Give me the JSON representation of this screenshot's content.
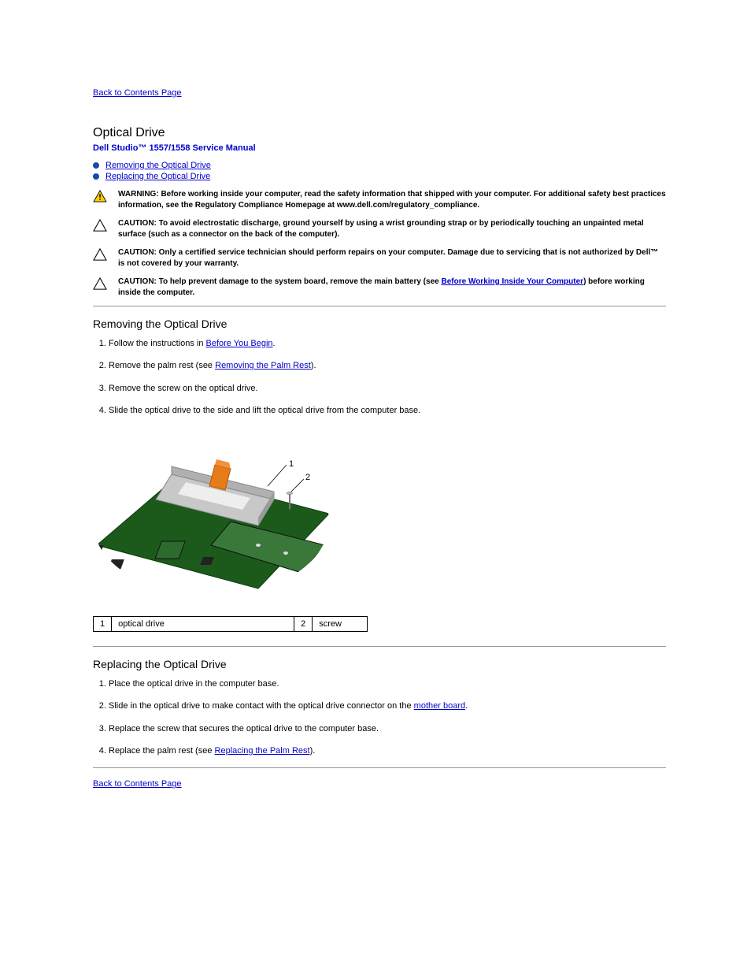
{
  "nav": {
    "back_top": "Back to Contents Page",
    "back_bottom": "Back to Contents Page"
  },
  "header": {
    "title": "Optical Drive",
    "manual": "Dell Studio™ 1557/1558 Service Manual"
  },
  "toc": {
    "items": [
      {
        "label": "Removing the Optical Drive"
      },
      {
        "label": "Replacing the Optical Drive"
      }
    ]
  },
  "warnings": {
    "w1_prefix": "WARNING: Before working inside your computer, read the safety information that shipped with your computer. For additional safety best practices information, see the Regulatory Compliance Homepage at www.dell.com/regulatory_compliance.",
    "c1_prefix": "CAUTION: ",
    "c1_text": "To avoid electrostatic discharge, ground yourself by using a wrist grounding strap or by periodically touching an unpainted metal surface (such as a connector on the back of the computer).",
    "c2_prefix": "CAUTION: ",
    "c2_text": "Only a certified service technician should perform repairs on your computer. Damage due to servicing that is not authorized by Dell™ is not covered by your warranty.",
    "c3_prefix": "CAUTION: ",
    "c3_text_before_link": "To help prevent damage to the system board, remove the main battery (see ",
    "c3_link": "Before Working Inside Your Computer",
    "c3_text_after_link": ") before working inside the computer."
  },
  "remove": {
    "heading": "Removing the Optical Drive",
    "steps": {
      "s1_before": "Follow the instructions in ",
      "s1_link": "Before You Begin",
      "s1_after": ".",
      "s2_before": "Remove the palm rest (see ",
      "s2_link": "Removing the Palm Rest",
      "s2_after": ").",
      "s3": "Remove the screw on the optical drive.",
      "s4": "Slide the optical drive to the side and lift the optical drive from the computer base."
    }
  },
  "callouts": {
    "c1n": "1",
    "c1": "optical drive",
    "c2n": "2",
    "c2": "screw"
  },
  "replace": {
    "heading": "Replacing the Optical Drive",
    "steps": {
      "s1": "Place the optical drive in the computer base.",
      "s2_before": "Slide in the optical drive to make contact with the optical drive connector on the ",
      "s2_link": "mother board",
      "s2_after": ".",
      "s3": "Replace the screw that secures the optical drive to the computer base.",
      "s4_before": "Replace the palm rest (see ",
      "s4_link": "Replacing the Palm Rest",
      "s4_after": ")."
    }
  }
}
